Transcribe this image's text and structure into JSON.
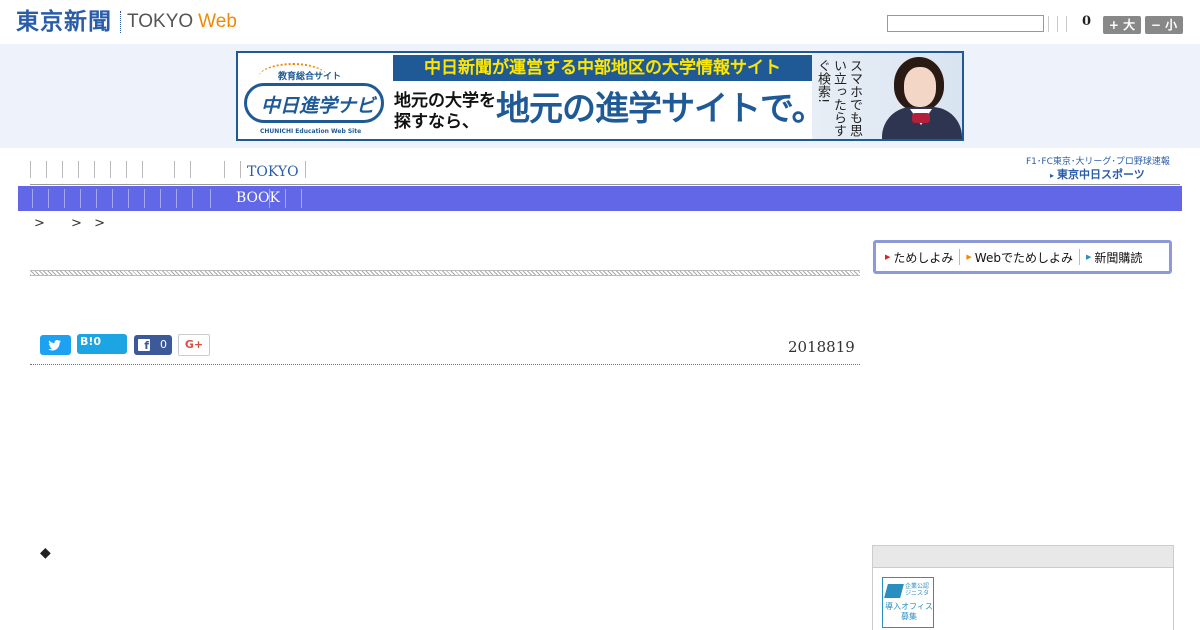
{
  "header": {
    "logo_main": "東京新聞",
    "logo_tokyo": "TOKYO",
    "logo_web": "Web",
    "search_value": "",
    "font_size_count": "0",
    "size_up_label": "+ 大",
    "size_down_label": "− 小"
  },
  "banner": {
    "small_label": "教育総合サイト",
    "logo_text": "中日進学ナビ",
    "logo_sub": "CHUNICHI Education Web Site",
    "headline": "中日新聞が運営する中部地区の大学情報サイト",
    "sub_line1": "地元の大学を",
    "sub_line2": "探すなら、",
    "big_text": "地元の進学サイトで。",
    "side_text": "スマホでも思い立ったらすぐ検索!"
  },
  "nav": {
    "tokyo_label": "TOKYO",
    "sports_top": "F1･FC東京･大リーグ･プロ野球速報",
    "sports_logo": "東京中日スポーツ",
    "book_label": "BOOK"
  },
  "breadcrumb": [
    ">",
    ">",
    ">"
  ],
  "social": {
    "hatena_label": "B!",
    "hatena_count": "0",
    "facebook_count": "0",
    "gplus_label": "G+"
  },
  "article": {
    "date": "2018819",
    "bullet": "◆"
  },
  "subscribe": {
    "items": [
      "ためしよみ",
      "Webでためしよみ",
      "新聞購読"
    ]
  },
  "side_ad": {
    "small_text": "企業公認ジニスタ",
    "text": "導入オフィス募集"
  },
  "colors": {
    "brand_blue": "#2a5ca8",
    "web_orange": "#f08a00",
    "nav_purple": "#6167e6",
    "twitter": "#1da1f2",
    "facebook": "#3c5a99"
  }
}
